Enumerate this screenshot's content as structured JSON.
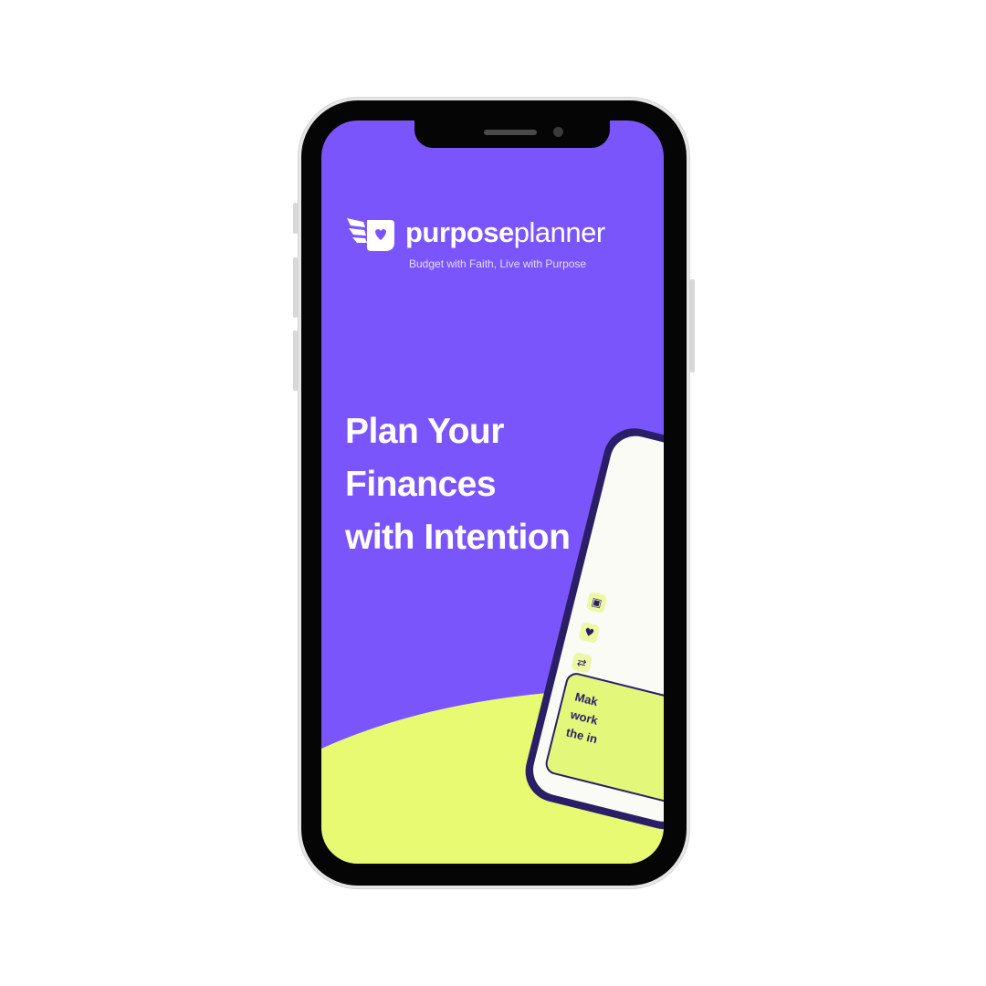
{
  "brand": {
    "name_bold": "purpose",
    "name_light": "planner",
    "tagline": "Budget with Faith, Live with Purpose"
  },
  "hero": {
    "headline_lines": [
      "Plan Your",
      "Finances",
      "with Intention"
    ]
  },
  "preview_card": {
    "lines": [
      "Mak",
      "work",
      "the in"
    ]
  },
  "colors": {
    "background": "#7b55fc",
    "accent": "#e7fa72",
    "ink": "#2a1f66",
    "device": "#050505"
  },
  "icons": [
    "wing-logo-icon",
    "gift-icon",
    "heart-icon",
    "handshake-icon"
  ]
}
